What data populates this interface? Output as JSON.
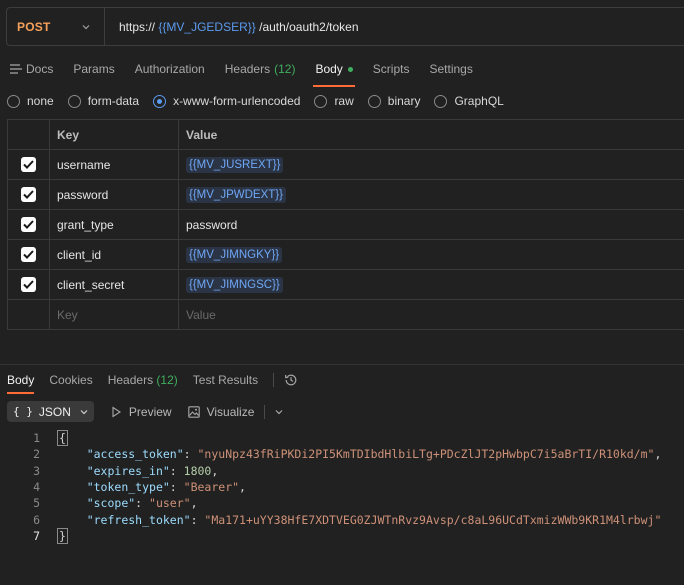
{
  "request": {
    "method": "POST",
    "url_prefix": "https://",
    "url_var": "{{MV_JGEDSER}}",
    "url_suffix": "/auth/oauth2/token"
  },
  "request_tabs": [
    {
      "label": "Docs"
    },
    {
      "label": "Params"
    },
    {
      "label": "Authorization"
    },
    {
      "label": "Headers",
      "count": "(12)"
    },
    {
      "label": "Body"
    },
    {
      "label": "Scripts"
    },
    {
      "label": "Settings"
    }
  ],
  "body_types": [
    "none",
    "form-data",
    "x-www-form-urlencoded",
    "raw",
    "binary",
    "GraphQL"
  ],
  "selected_body_type": "x-www-form-urlencoded",
  "params_table": {
    "headers": {
      "key": "Key",
      "value": "Value"
    },
    "rows": [
      {
        "key": "username",
        "value": "{{MV_JUSREXT}}"
      },
      {
        "key": "password",
        "value": "{{MV_JPWDEXT}}"
      },
      {
        "key": "grant_type",
        "value": "password"
      },
      {
        "key": "client_id",
        "value": "{{MV_JIMNGKY}}"
      },
      {
        "key": "client_secret",
        "value": "{{MV_JIMNGSC}}"
      }
    ],
    "placeholder": {
      "key": "Key",
      "value": "Value"
    }
  },
  "response_tabs": [
    {
      "label": "Body"
    },
    {
      "label": "Cookies"
    },
    {
      "label": "Headers",
      "count": "(12)"
    },
    {
      "label": "Test Results"
    }
  ],
  "format_bar": {
    "format": "JSON",
    "braces": "{ }",
    "preview": "Preview",
    "visualize": "Visualize"
  },
  "response_body": {
    "line_numbers": [
      "1",
      "2",
      "3",
      "4",
      "5",
      "6",
      "7"
    ],
    "open_brace": "{",
    "close_brace": "}",
    "fields": [
      {
        "key": "\"access_token\"",
        "value": "\"nyuNpz43fRiPKDi2PI5KmTDIbdHlbiLTg+PDcZlJT2pHwbpC7i5aBrTI/R10kd/m\"",
        "type": "string"
      },
      {
        "key": "\"expires_in\"",
        "value": "1800",
        "type": "number"
      },
      {
        "key": "\"token_type\"",
        "value": "\"Bearer\"",
        "type": "string"
      },
      {
        "key": "\"scope\"",
        "value": "\"user\"",
        "type": "string"
      },
      {
        "key": "\"refresh_token\"",
        "value": "\"Ma171+uYY38HfE7XDTVEG0ZJWTnRvz9Avsp/c8aL96UCdTxmizWWb9KR1M4lrbwj\"",
        "type": "string"
      }
    ]
  },
  "colors": {
    "method": "#f5a05a",
    "variable": "#5b9bf0",
    "accent": "#ff6c37",
    "count_green": "#3fae5e"
  }
}
